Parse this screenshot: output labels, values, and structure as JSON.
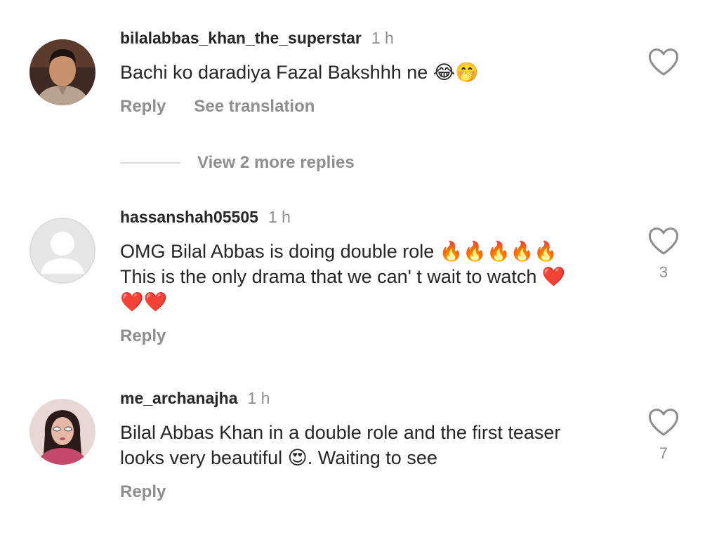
{
  "comments": [
    {
      "username": "bilalabbas_khan_the_superstar",
      "time": "1 h",
      "text": "Bachi ko daradiya Fazal Bakshhh ne 😂🤭",
      "reply_label": "Reply",
      "translate_label": "See translation",
      "likes": ""
    },
    {
      "username": "hassanshah05505",
      "time": "1 h",
      "text_line1": "OMG Bilal Abbas is doing double role 🔥🔥🔥🔥🔥",
      "text_line2": "This is the only drama that we can' t wait to watch ❤️",
      "text_line3": "❤️❤️",
      "reply_label": "Reply",
      "likes": "3"
    },
    {
      "username": "me_archanajha",
      "time": "1 h",
      "text_line1": "Bilal Abbas Khan in a double role and the first teaser",
      "text_line2": "looks very beautiful 😍. Waiting to see",
      "reply_label": "Reply",
      "likes": "7"
    }
  ],
  "view_more_replies": "View 2 more replies",
  "colors": {
    "text": "#262626",
    "secondary": "#8e8e8e",
    "divider": "#dbdbdb"
  }
}
